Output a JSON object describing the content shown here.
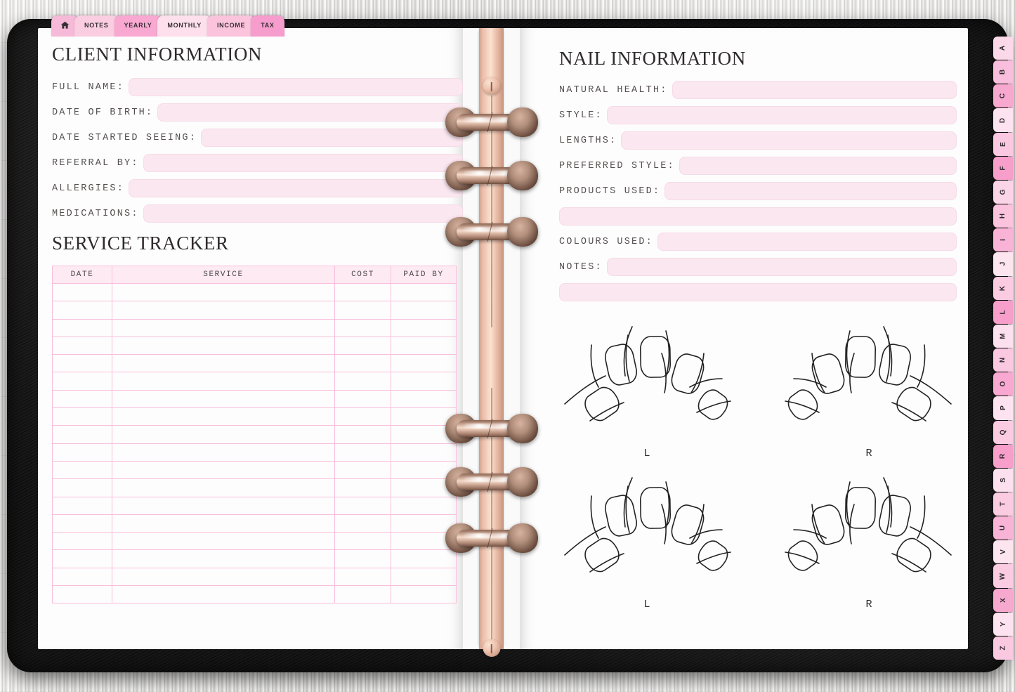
{
  "top_tabs": [
    {
      "label": "",
      "icon": "home-icon",
      "shade": "#f7b9d8"
    },
    {
      "label": "NOTES",
      "shade": "#fbcde0"
    },
    {
      "label": "YEARLY",
      "shade": "#f9a8d2"
    },
    {
      "label": "MONTHLY",
      "shade": "#fde0ec"
    },
    {
      "label": "INCOME",
      "shade": "#fbc3dc"
    },
    {
      "label": "TAX",
      "shade": "#f79dcd"
    }
  ],
  "alphabet_tabs": [
    {
      "letter": "A",
      "shade": "#fbd9e8"
    },
    {
      "letter": "B",
      "shade": "#f9bedb"
    },
    {
      "letter": "C",
      "shade": "#f7a8cf"
    },
    {
      "letter": "D",
      "shade": "#fde3ef"
    },
    {
      "letter": "E",
      "shade": "#fbc8e1"
    },
    {
      "letter": "F",
      "shade": "#f79ecb"
    },
    {
      "letter": "G",
      "shade": "#fbd4e7"
    },
    {
      "letter": "H",
      "shade": "#fbc3de"
    },
    {
      "letter": "I",
      "shade": "#f9b3d6"
    },
    {
      "letter": "J",
      "shade": "#fde5f0"
    },
    {
      "letter": "K",
      "shade": "#fbcbe2"
    },
    {
      "letter": "L",
      "shade": "#f79ecb"
    },
    {
      "letter": "M",
      "shade": "#fde0ee"
    },
    {
      "letter": "N",
      "shade": "#fbc8e1"
    },
    {
      "letter": "O",
      "shade": "#f9a8d2"
    },
    {
      "letter": "P",
      "shade": "#fde3ef"
    },
    {
      "letter": "Q",
      "shade": "#fbcbe2"
    },
    {
      "letter": "R",
      "shade": "#f79ecb"
    },
    {
      "letter": "S",
      "shade": "#fde0ee"
    },
    {
      "letter": "T",
      "shade": "#fbcbe2"
    },
    {
      "letter": "U",
      "shade": "#f9b3d6"
    },
    {
      "letter": "V",
      "shade": "#fde5f0"
    },
    {
      "letter": "W",
      "shade": "#fbcbe2"
    },
    {
      "letter": "X",
      "shade": "#f7a8cf"
    },
    {
      "letter": "Y",
      "shade": "#fde3ef"
    },
    {
      "letter": "Z",
      "shade": "#fbc8e1"
    }
  ],
  "left_page": {
    "client_section": {
      "title": "CLIENT INFORMATION",
      "fields": [
        {
          "label": "FULL NAME:",
          "value": ""
        },
        {
          "label": "DATE OF BIRTH:",
          "value": ""
        },
        {
          "label": "DATE STARTED SEEING:",
          "value": ""
        },
        {
          "label": "REFERRAL BY:",
          "value": ""
        },
        {
          "label": "ALLERGIES:",
          "value": ""
        },
        {
          "label": "MEDICATIONS:",
          "value": ""
        }
      ]
    },
    "service_tracker": {
      "title": "SERVICE TRACKER",
      "columns": [
        "DATE",
        "SERVICE",
        "COST",
        "PAID BY"
      ],
      "row_count": 18,
      "rows": [
        [
          "",
          "",
          "",
          ""
        ],
        [
          "",
          "",
          "",
          ""
        ],
        [
          "",
          "",
          "",
          ""
        ],
        [
          "",
          "",
          "",
          ""
        ],
        [
          "",
          "",
          "",
          ""
        ],
        [
          "",
          "",
          "",
          ""
        ],
        [
          "",
          "",
          "",
          ""
        ],
        [
          "",
          "",
          "",
          ""
        ],
        [
          "",
          "",
          "",
          ""
        ],
        [
          "",
          "",
          "",
          ""
        ],
        [
          "",
          "",
          "",
          ""
        ],
        [
          "",
          "",
          "",
          ""
        ],
        [
          "",
          "",
          "",
          ""
        ],
        [
          "",
          "",
          "",
          ""
        ],
        [
          "",
          "",
          "",
          ""
        ],
        [
          "",
          "",
          "",
          ""
        ],
        [
          "",
          "",
          "",
          ""
        ],
        [
          "",
          "",
          "",
          ""
        ]
      ]
    }
  },
  "right_page": {
    "nail_section": {
      "title": "NAIL INFORMATION",
      "fields": [
        {
          "label": "NATURAL HEALTH:",
          "value": ""
        },
        {
          "label": "STYLE:",
          "value": ""
        },
        {
          "label": "LENGTHS:",
          "value": ""
        },
        {
          "label": "PREFERRED STYLE:",
          "value": ""
        },
        {
          "label": "PRODUCTS USED:",
          "value": ""
        },
        {
          "label": "",
          "value": ""
        },
        {
          "label": "COLOURS USED:",
          "value": ""
        },
        {
          "label": "NOTES:",
          "value": ""
        },
        {
          "label": "",
          "value": ""
        }
      ]
    },
    "hand_diagrams": [
      {
        "left_label": "L",
        "right_label": "R"
      },
      {
        "left_label": "L",
        "right_label": "R"
      }
    ]
  },
  "colors": {
    "field_fill": "#fbe7f0",
    "field_border": "#f6dbe7",
    "table_line": "#f9bedb",
    "table_header_fill": "#fdeaf3",
    "binder": "#141414",
    "ring_metal": "#e9bca8",
    "text": "#2f2b2c"
  }
}
